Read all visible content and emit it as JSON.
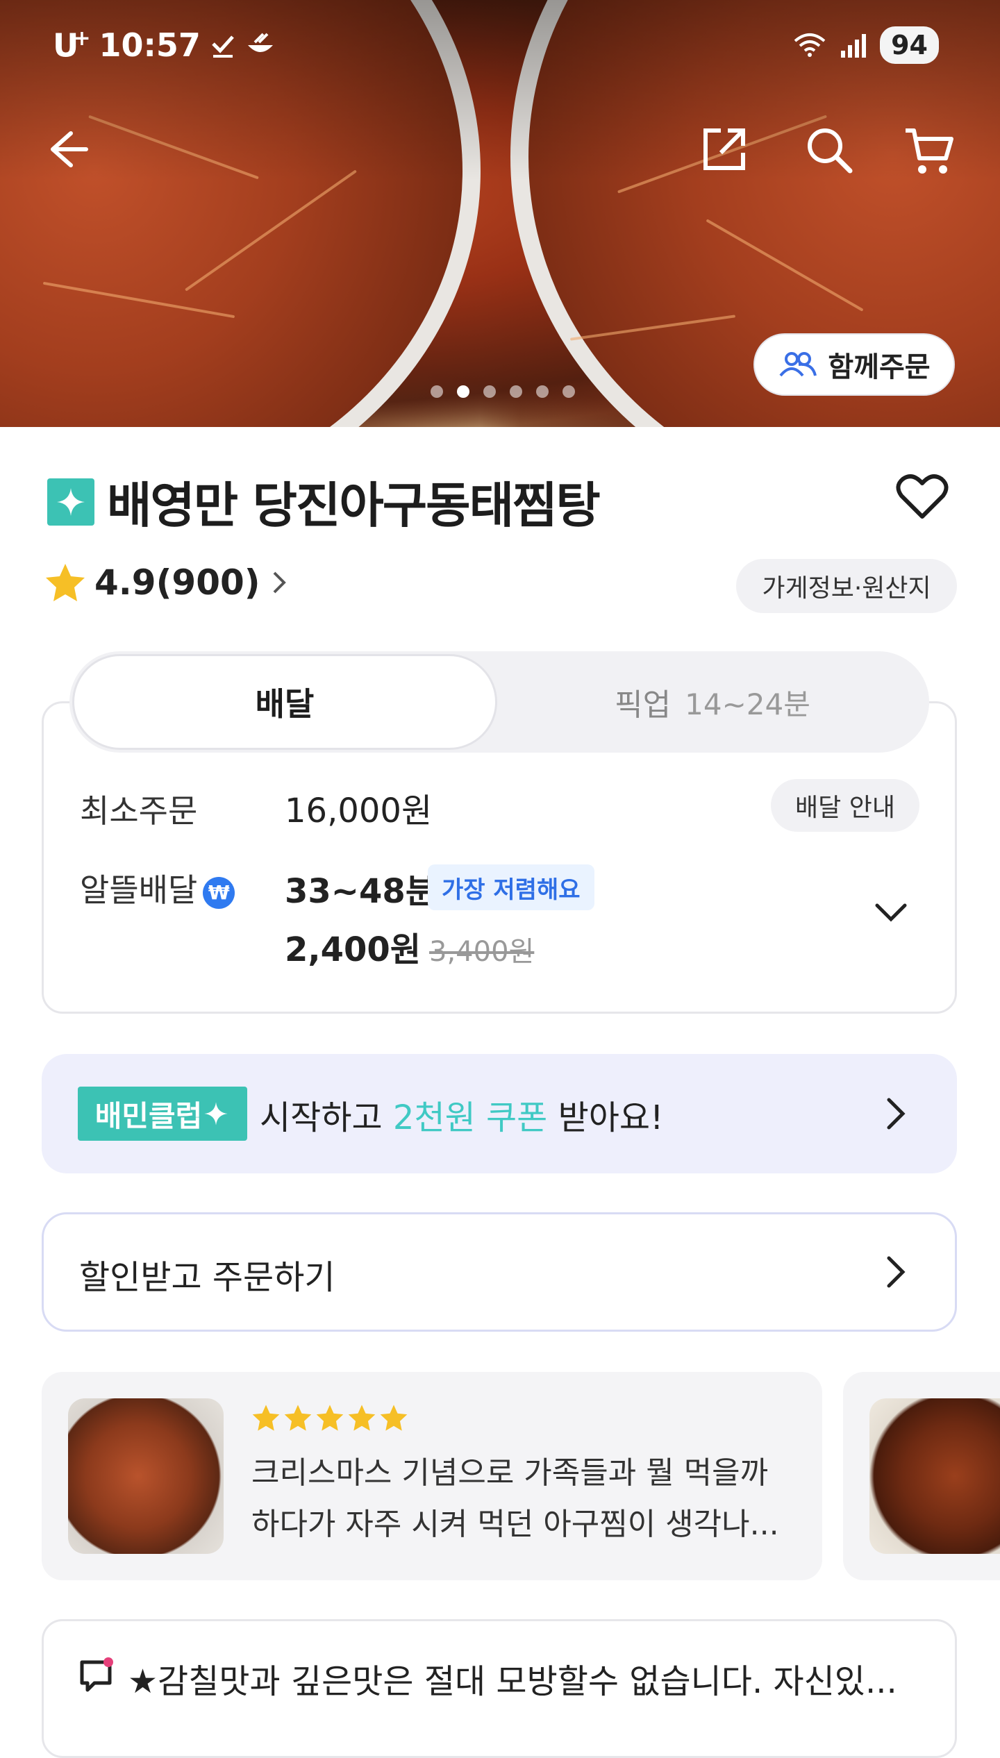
{
  "status_bar": {
    "carrier": "U",
    "carrier_sup": "+",
    "time": "10:57",
    "battery": "94"
  },
  "hero": {
    "group_order_label": "함께주문",
    "carousel_count": 6,
    "carousel_active_index": 1
  },
  "store": {
    "name": "배영만 당진아구동태찜탕",
    "rating": "4.9(900)",
    "info_chip": "가게정보·원산지"
  },
  "order_tabs": [
    {
      "label": "배달",
      "time": ""
    },
    {
      "label": "픽업",
      "time": "14~24분"
    }
  ],
  "delivery": {
    "min_order_label": "최소주문",
    "min_order_value": "16,000원",
    "guide_chip": "배달 안내",
    "type_label": "알뜰배달",
    "type_badge": "₩",
    "time": "33~48분",
    "cheap_tag": "가장 저렴해요",
    "fee": "2,400원",
    "original_fee": "3,400원"
  },
  "club_banner": {
    "logo": "배민클럽",
    "text_before": "시작하고 ",
    "highlight": "2천원 쿠폰",
    "text_after": " 받아요!"
  },
  "discount": {
    "label": "할인받고 주문하기"
  },
  "review": {
    "stars": 5,
    "line1": "크리스마스 기념으로 가족들과 뭘 먹을까",
    "line2": "하다가 자주 시켜 먹던 아구찜이 생각나..."
  },
  "notice": {
    "text": "★감칠맛과 깊은맛은 절대 모방할수 없습니다. 자신있..."
  },
  "colors": {
    "accent_mint": "#3cc2b4",
    "highlight_cyan": "#40c9c4",
    "tag_blue": "#2f6fe6",
    "star_yellow": "#f6bf26"
  }
}
